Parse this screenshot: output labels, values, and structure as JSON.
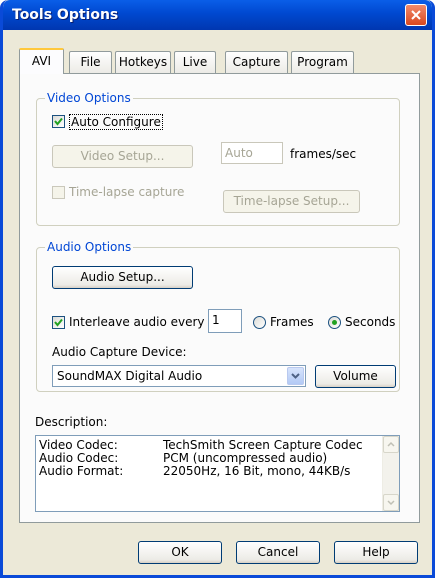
{
  "window": {
    "title": "Tools Options"
  },
  "tabs": [
    "AVI",
    "File",
    "Hotkeys",
    "Live",
    "Capture",
    "Program"
  ],
  "video": {
    "group_label": "Video Options",
    "auto_configure_label": "Auto Configure",
    "auto_configure_checked": true,
    "video_setup_label": "Video Setup...",
    "frame_rate_value": "Auto",
    "frame_rate_unit": "frames/sec",
    "timelapse_label": "Time-lapse capture",
    "timelapse_checked": false,
    "timelapse_setup_label": "Time-lapse Setup..."
  },
  "audio": {
    "group_label": "Audio Options",
    "audio_setup_label": "Audio Setup...",
    "interleave_label": "Interleave audio every",
    "interleave_checked": true,
    "interleave_value": "1",
    "frames_label": "Frames",
    "seconds_label": "Seconds",
    "selected_unit": "Seconds",
    "device_label": "Audio Capture Device:",
    "device_value": "SoundMAX Digital Audio",
    "volume_label": "Volume"
  },
  "description": {
    "label": "Description:",
    "rows": [
      {
        "key": "Video Codec:",
        "value": "TechSmith Screen Capture Codec"
      },
      {
        "key": "Audio Codec:",
        "value": "PCM (uncompressed audio)"
      },
      {
        "key": "Audio Format:",
        "value": "22050Hz, 16 Bit, mono, 44KB/s"
      }
    ]
  },
  "buttons": {
    "ok": "OK",
    "cancel": "Cancel",
    "help": "Help"
  }
}
